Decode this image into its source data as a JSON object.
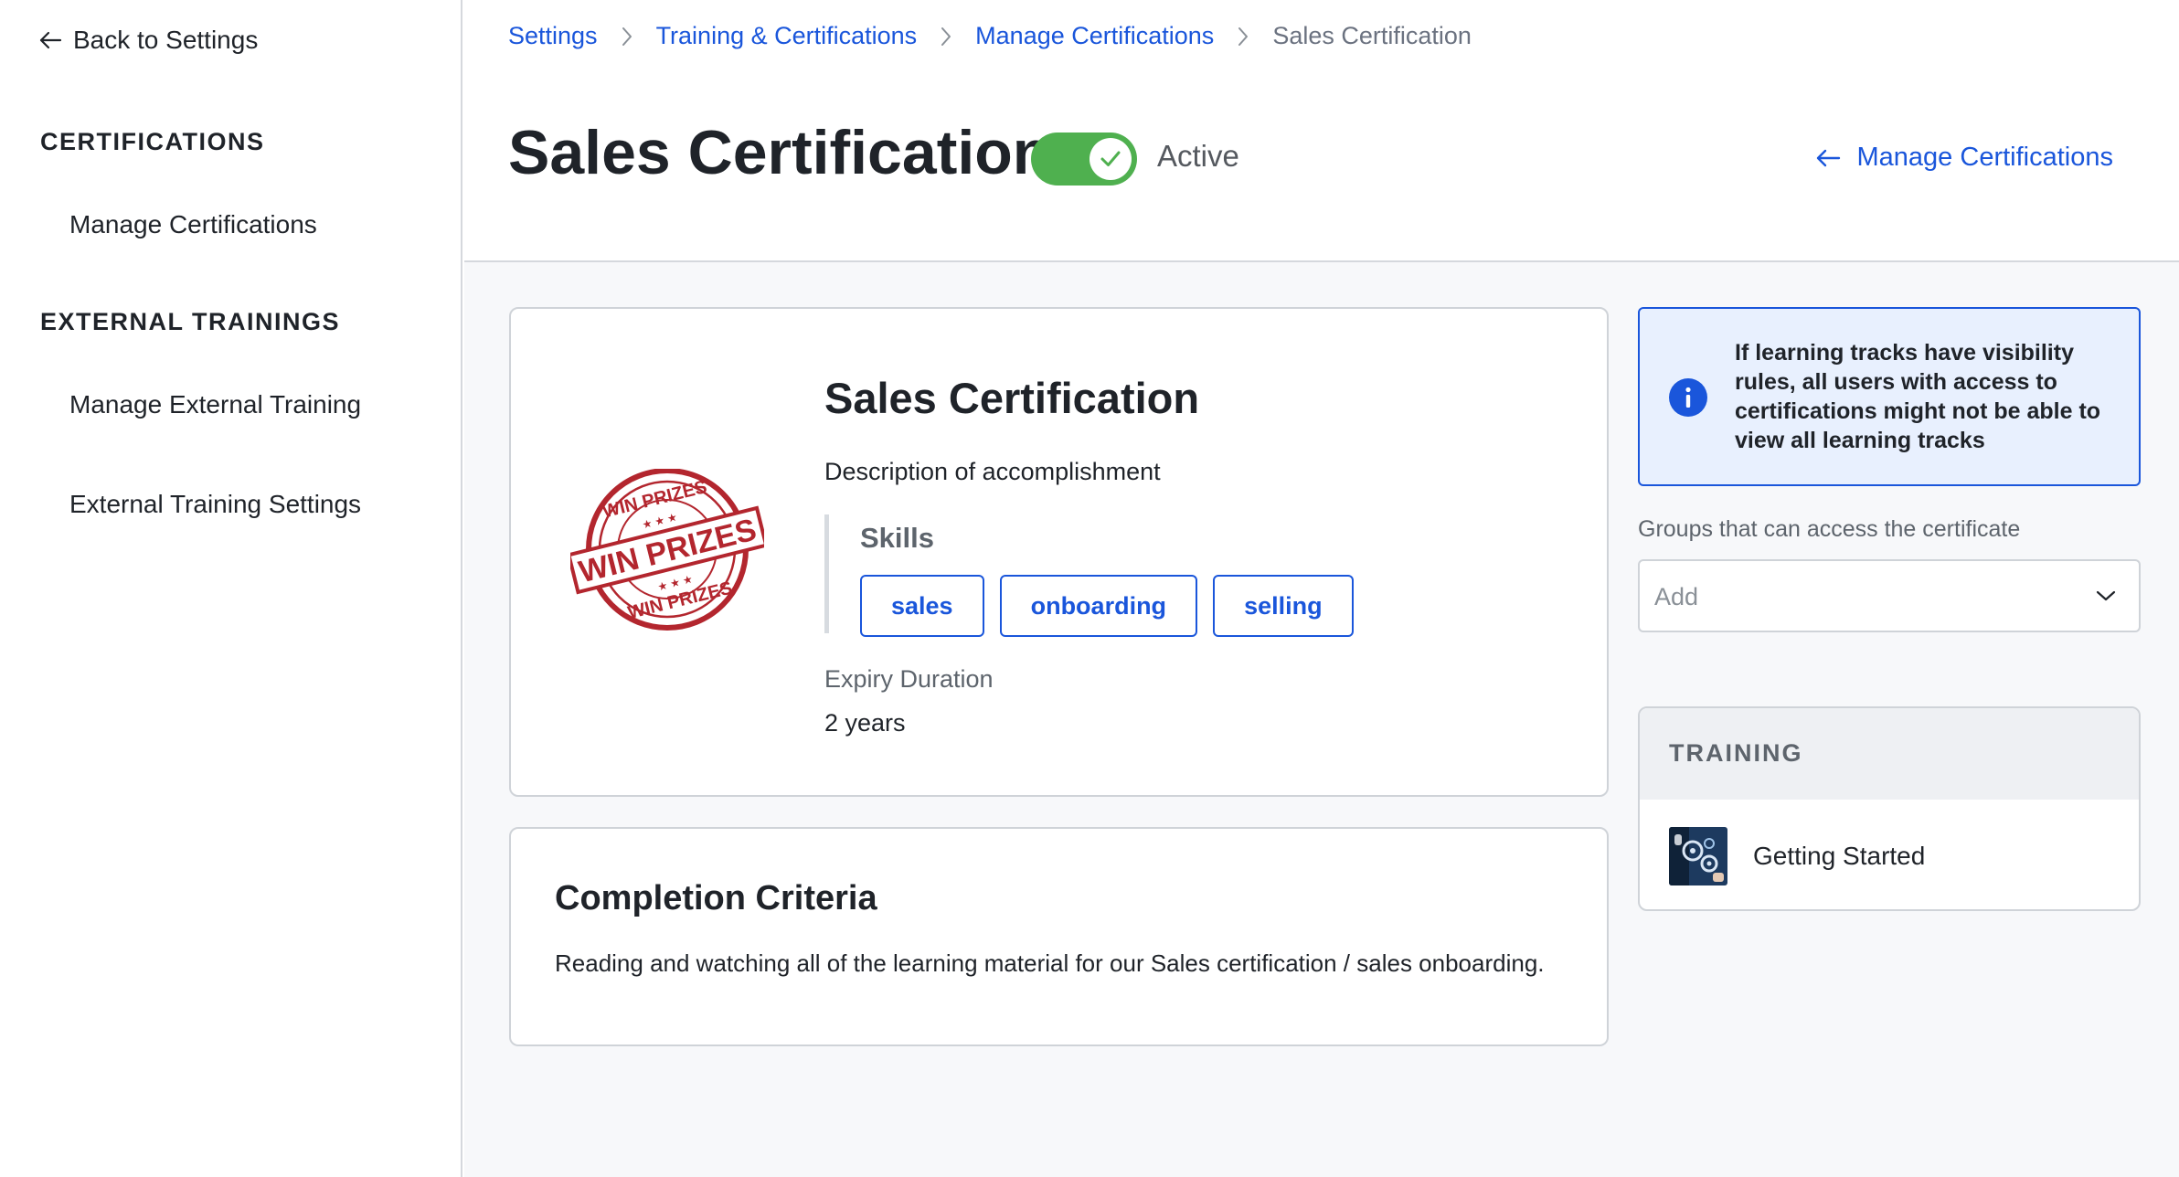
{
  "sidebar": {
    "back_label": "Back to Settings",
    "sections": [
      {
        "heading": "CERTIFICATIONS",
        "items": [
          "Manage Certifications"
        ]
      },
      {
        "heading": "EXTERNAL TRAININGS",
        "items": [
          "Manage External Training",
          "External Training Settings"
        ]
      }
    ]
  },
  "breadcrumb": {
    "items": [
      "Settings",
      "Training & Certifications",
      "Manage Certifications"
    ],
    "current": "Sales Certification"
  },
  "header": {
    "title": "Sales Certification",
    "toggle_on": true,
    "status": "Active",
    "manage_link": "Manage Certifications"
  },
  "certificate": {
    "badge_text": "WIN PRIZES",
    "title": "Sales Certification",
    "description": "Description of accomplishment",
    "skills_label": "Skills",
    "skills": [
      "sales",
      "onboarding",
      "selling"
    ],
    "expiry_label": "Expiry Duration",
    "expiry_value": "2 years"
  },
  "criteria": {
    "title": "Completion Criteria",
    "text": "Reading and watching all of the learning material for our Sales certification / sales onboarding."
  },
  "info": {
    "text": "If learning tracks have visibility rules, all users with access to certifications might not be able to view all learning tracks"
  },
  "groups": {
    "label": "Groups that can access the certificate",
    "placeholder": "Add"
  },
  "training": {
    "header": "TRAINING",
    "items": [
      "Getting Started"
    ]
  },
  "colors": {
    "accent": "#1a56db",
    "toggle_on": "#4fb04f",
    "info_bg": "#e8f0fe",
    "stamp_red": "#b3262e"
  }
}
